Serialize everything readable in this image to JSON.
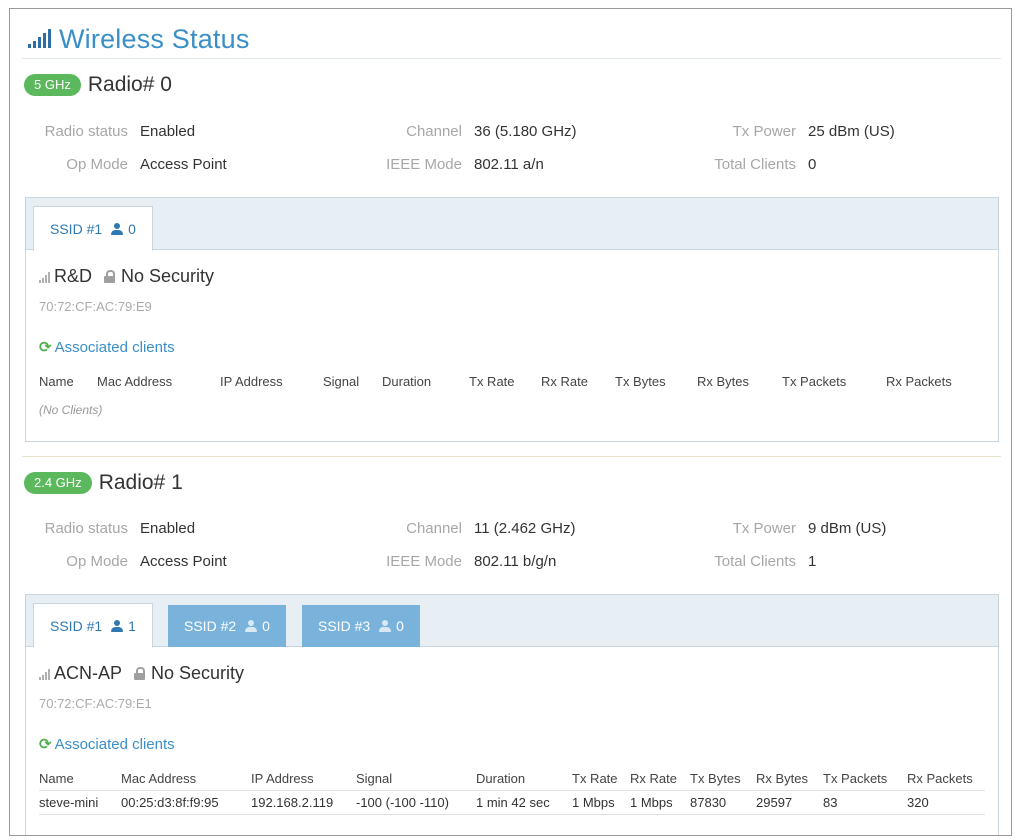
{
  "page": {
    "title": "Wireless Status",
    "icon": "signal-bars-icon"
  },
  "colors": {
    "accent": "#3a8fc7",
    "badge": "#5cb85c",
    "tab_inactive": "#79b3dc",
    "tab_bar": "#e7eef4"
  },
  "labels": {
    "radio_status": "Radio status",
    "op_mode": "Op Mode",
    "channel": "Channel",
    "ieee_mode": "IEEE Mode",
    "tx_power": "Tx Power",
    "total_clients": "Total Clients",
    "associated_clients": "Associated clients",
    "no_security": "No Security",
    "no_clients": "(No Clients)"
  },
  "columns": [
    "Name",
    "Mac Address",
    "IP Address",
    "Signal",
    "Duration",
    "Tx Rate",
    "Rx Rate",
    "Tx Bytes",
    "Rx Bytes",
    "Tx Packets",
    "Rx Packets"
  ],
  "radios": [
    {
      "band": "5 GHz",
      "name": "Radio# 0",
      "radio_status": "Enabled",
      "op_mode": "Access Point",
      "channel": "36 (5.180 GHz)",
      "ieee_mode": "802.11 a/n",
      "tx_power": "25 dBm (US)",
      "total_clients": "0",
      "tabs": [
        {
          "label": "SSID #1",
          "count": "0",
          "active": true
        }
      ],
      "ssid": {
        "name": "R&D",
        "security": "No Security",
        "mac": "70:72:CF:AC:79:E9"
      },
      "clients": []
    },
    {
      "band": "2.4 GHz",
      "name": "Radio# 1",
      "radio_status": "Enabled",
      "op_mode": "Access Point",
      "channel": "11 (2.462 GHz)",
      "ieee_mode": "802.11 b/g/n",
      "tx_power": "9 dBm (US)",
      "total_clients": "1",
      "tabs": [
        {
          "label": "SSID #1",
          "count": "1",
          "active": true
        },
        {
          "label": "SSID #2",
          "count": "0",
          "active": false
        },
        {
          "label": "SSID #3",
          "count": "0",
          "active": false
        }
      ],
      "ssid": {
        "name": "ACN-AP",
        "security": "No Security",
        "mac": "70:72:CF:AC:79:E1"
      },
      "clients": [
        [
          "steve-mini",
          "00:25:d3:8f:f9:95",
          "192.168.2.119",
          "-100 (-100 -110)",
          "1 min 42 sec",
          "1 Mbps",
          "1 Mbps",
          "87830",
          "29597",
          "83",
          "320"
        ]
      ]
    }
  ]
}
